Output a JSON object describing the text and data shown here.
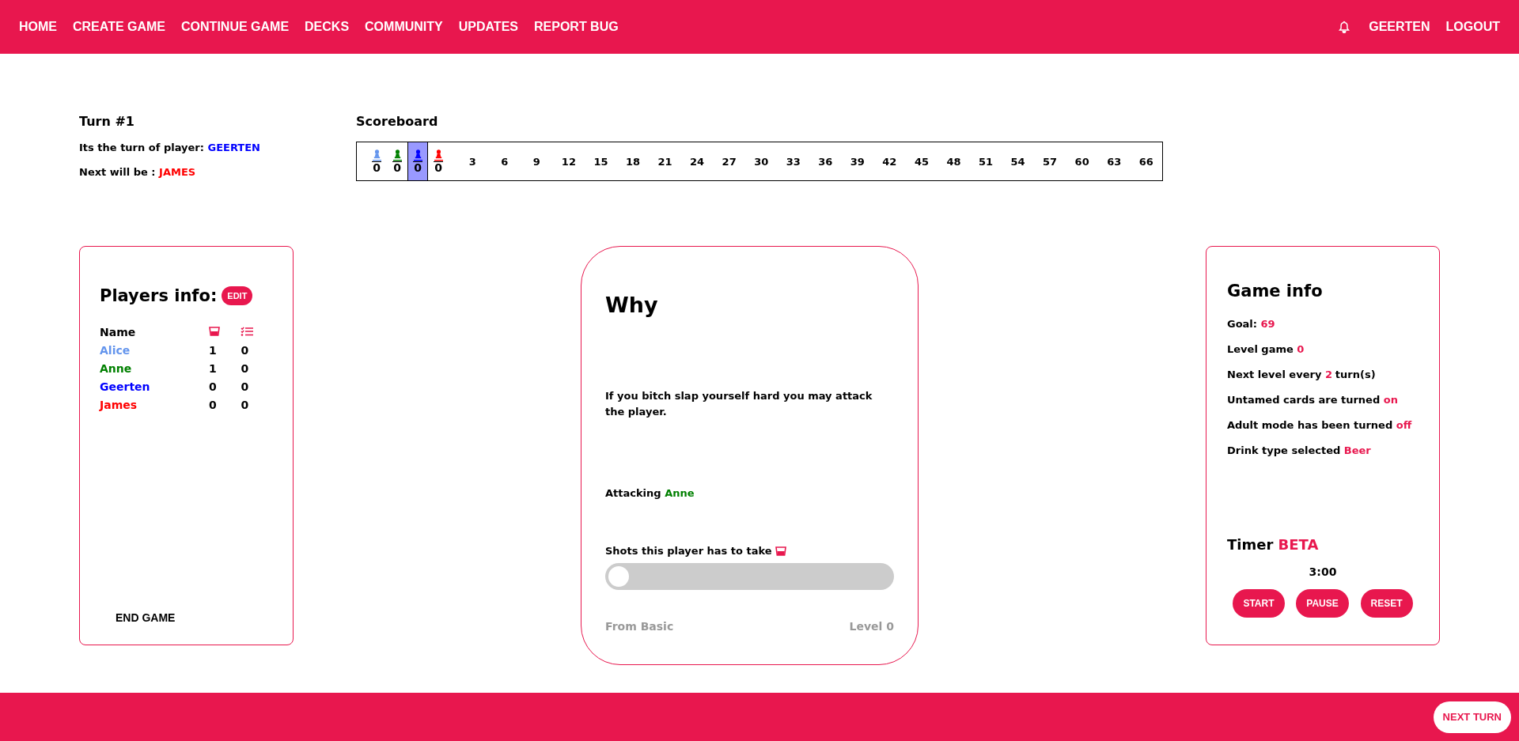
{
  "nav": {
    "items": [
      "HOME",
      "CREATE GAME",
      "CONTINUE GAME",
      "DECKS",
      "COMMUNITY",
      "UPDATES",
      "REPORT BUG"
    ],
    "user": "GEERTEN",
    "logout": "LOGOUT"
  },
  "turn": {
    "title": "Turn #1",
    "current_label": "Its the turn of player:",
    "current": {
      "name": "GEERTEN",
      "color": "#0000ff"
    },
    "next_label": "Next will be :",
    "next": {
      "name": "JAMES",
      "color": "#ff0000"
    }
  },
  "scoreboard": {
    "title": "Scoreboard",
    "players": [
      {
        "color": "#6495ed",
        "score": "0",
        "selected": false
      },
      {
        "color": "#008000",
        "score": "0",
        "selected": false
      },
      {
        "color": "#0000ff",
        "score": "0",
        "selected": true
      },
      {
        "color": "#ff0000",
        "score": "0",
        "selected": false
      }
    ],
    "marks": [
      "3",
      "6",
      "9",
      "12",
      "15",
      "18",
      "21",
      "24",
      "27",
      "30",
      "33",
      "36",
      "39",
      "42",
      "45",
      "48",
      "51",
      "54",
      "57",
      "60",
      "63",
      "66"
    ]
  },
  "players_info": {
    "title": "Players info:",
    "edit": "EDIT",
    "name_header": "Name",
    "rows": [
      {
        "name": "Alice",
        "color": "#6495ed",
        "shots": "1",
        "cards": "0"
      },
      {
        "name": "Anne",
        "color": "#008000",
        "shots": "1",
        "cards": "0"
      },
      {
        "name": "Geerten",
        "color": "#0000ff",
        "shots": "0",
        "cards": "0"
      },
      {
        "name": "James",
        "color": "#ff0000",
        "shots": "0",
        "cards": "0"
      }
    ],
    "end_game": "END GAME"
  },
  "card": {
    "title": "Why",
    "text": "If you bitch slap yourself hard you may attack the player.",
    "attacking_label": "Attacking",
    "attacking": {
      "name": "Anne",
      "color": "#008000"
    },
    "shots_label": "Shots this player has to take",
    "shots_slider": {
      "level": 0
    },
    "source": "From Basic",
    "level_label": "Level 0"
  },
  "game_info": {
    "title": "Game info",
    "lines": [
      {
        "label": "Goal:",
        "value": "69"
      },
      {
        "label": "Level game",
        "value": "0"
      },
      {
        "label": "Next level every",
        "value": "2",
        "suffix": "turn(s)"
      },
      {
        "label": "Untamed cards are turned",
        "value": "on"
      },
      {
        "label": "Adult mode has been turned",
        "value": "off"
      },
      {
        "label": "Drink type selected",
        "value": "Beer"
      }
    ],
    "timer_label": "Timer",
    "timer_badge": "BETA",
    "time": "3:00",
    "buttons": [
      "START",
      "PAUSE",
      "RESET"
    ]
  },
  "footer": {
    "next_turn": "NEXT TURN"
  }
}
